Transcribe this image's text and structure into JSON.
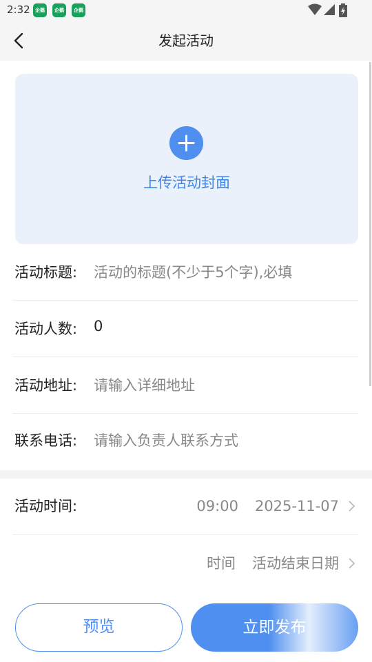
{
  "status_bar": {
    "time": "2:32",
    "notif_badge": "企鹅课"
  },
  "header": {
    "title": "发起活动"
  },
  "upload": {
    "label": "上传活动封面"
  },
  "form": {
    "title": {
      "label": "活动标题:",
      "placeholder": "活动的标题(不少于5个字),必填"
    },
    "people": {
      "label": "活动人数:",
      "value": "0"
    },
    "address": {
      "label": "活动地址:",
      "placeholder": "请输入详细地址"
    },
    "phone": {
      "label": "联系电话:",
      "placeholder": "请输入负责人联系方式"
    }
  },
  "time_section": {
    "start": {
      "label": "活动时间:",
      "time": "09:00",
      "date": "2025-11-07"
    },
    "end": {
      "time": "时间",
      "date": "活动结束日期"
    }
  },
  "buttons": {
    "preview": "预览",
    "publish": "立即发布"
  },
  "colors": {
    "accent": "#4e8ff0",
    "upload_bg": "#ebf1fb",
    "upload_text": "#3d86e8"
  }
}
